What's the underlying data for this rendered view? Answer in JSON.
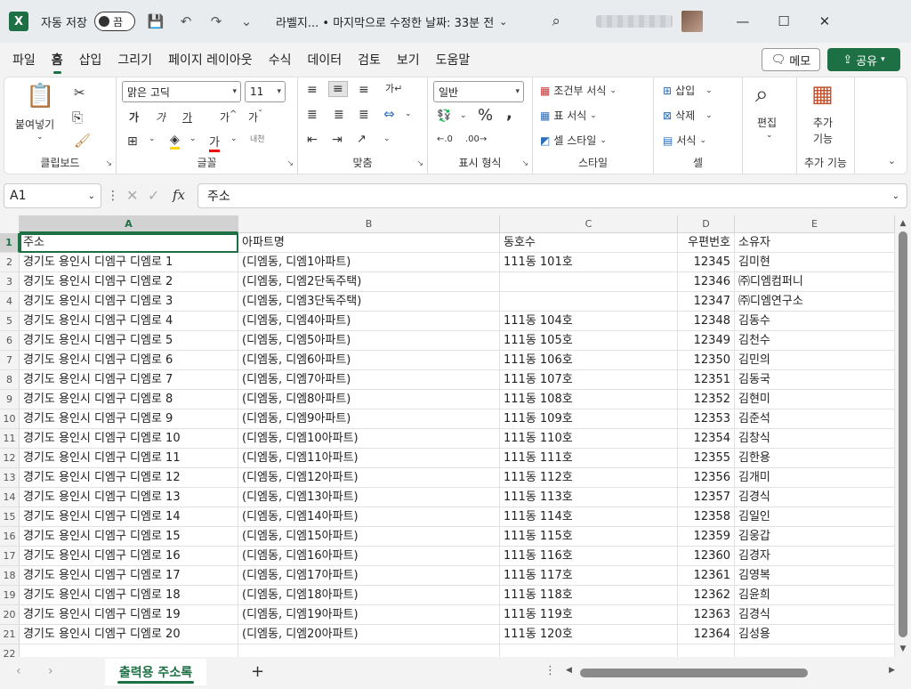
{
  "titlebar": {
    "app_icon": "X",
    "autosave_label": "자동 저장",
    "autosave_state": "끔",
    "doc_title": "라벨지... • 마지막으로 수정한 날짜: 33분 전",
    "doc_title_chevron": "⌄"
  },
  "menu": {
    "items": [
      "파일",
      "홈",
      "삽입",
      "그리기",
      "페이지 레이아웃",
      "수식",
      "데이터",
      "검토",
      "보기",
      "도움말"
    ],
    "active": "홈",
    "memo_label": "메모",
    "share_label": "공유"
  },
  "ribbon": {
    "clipboard": {
      "paste": "붙여넣기",
      "label": "클립보드"
    },
    "font": {
      "name": "맑은 고딕",
      "size": "11",
      "label": "글꼴"
    },
    "align": {
      "label": "맞춤"
    },
    "number": {
      "format": "일반",
      "label": "표시 형식"
    },
    "style": {
      "conditional": "조건부 서식",
      "table": "표 서식",
      "cell": "셀 스타일",
      "label": "스타일"
    },
    "cells": {
      "insert": "삽입",
      "delete": "삭제",
      "format": "서식",
      "label": "셀"
    },
    "editing": {
      "label": "편집"
    },
    "addins": {
      "label_line1": "추가",
      "label_line2": "기능",
      "group_label": "추가 기능"
    }
  },
  "formula_bar": {
    "name_box": "A1",
    "formula": "주소"
  },
  "grid": {
    "columns": [
      "A",
      "B",
      "C",
      "D",
      "E"
    ],
    "rows": [
      {
        "n": "1",
        "a": "주소",
        "b": "아파트명",
        "c": "동호수",
        "d": "우편번호",
        "e": "소유자"
      },
      {
        "n": "2",
        "a": "경기도 용인시 디엠구 디엠로 1",
        "b": "(디엠동, 디엠1아파트)",
        "c": "111동 101호",
        "d": "12345",
        "e": "김미현"
      },
      {
        "n": "3",
        "a": "경기도 용인시 디엠구 디엠로 2",
        "b": "(디엠동, 디엠2단독주택)",
        "c": "",
        "d": "12346",
        "e": "㈜디엠컴퍼니"
      },
      {
        "n": "4",
        "a": "경기도 용인시 디엠구 디엠로 3",
        "b": "(디엠동, 디엠3단독주택)",
        "c": "",
        "d": "12347",
        "e": "㈜디엠연구소"
      },
      {
        "n": "5",
        "a": "경기도 용인시 디엠구 디엠로 4",
        "b": "(디엠동, 디엠4아파트)",
        "c": "111동 104호",
        "d": "12348",
        "e": "김동수"
      },
      {
        "n": "6",
        "a": "경기도 용인시 디엠구 디엠로 5",
        "b": "(디엠동, 디엠5아파트)",
        "c": "111동 105호",
        "d": "12349",
        "e": "김천수"
      },
      {
        "n": "7",
        "a": "경기도 용인시 디엠구 디엠로 6",
        "b": "(디엠동, 디엠6아파트)",
        "c": "111동 106호",
        "d": "12350",
        "e": "김민의"
      },
      {
        "n": "8",
        "a": "경기도 용인시 디엠구 디엠로 7",
        "b": "(디엠동, 디엠7아파트)",
        "c": "111동 107호",
        "d": "12351",
        "e": "김동국"
      },
      {
        "n": "9",
        "a": "경기도 용인시 디엠구 디엠로 8",
        "b": "(디엠동, 디엠8아파트)",
        "c": "111동 108호",
        "d": "12352",
        "e": "김현미"
      },
      {
        "n": "10",
        "a": "경기도 용인시 디엠구 디엠로 9",
        "b": "(디엠동, 디엠9아파트)",
        "c": "111동 109호",
        "d": "12353",
        "e": "김준석"
      },
      {
        "n": "11",
        "a": "경기도 용인시 디엠구 디엠로 10",
        "b": "(디엠동, 디엠10아파트)",
        "c": "111동 110호",
        "d": "12354",
        "e": "김창식"
      },
      {
        "n": "12",
        "a": "경기도 용인시 디엠구 디엠로 11",
        "b": "(디엠동, 디엠11아파트)",
        "c": "111동 111호",
        "d": "12355",
        "e": "김한용"
      },
      {
        "n": "13",
        "a": "경기도 용인시 디엠구 디엠로 12",
        "b": "(디엠동, 디엠12아파트)",
        "c": "111동 112호",
        "d": "12356",
        "e": "김개미"
      },
      {
        "n": "14",
        "a": "경기도 용인시 디엠구 디엠로 13",
        "b": "(디엠동, 디엠13아파트)",
        "c": "111동 113호",
        "d": "12357",
        "e": "김경식"
      },
      {
        "n": "15",
        "a": "경기도 용인시 디엠구 디엠로 14",
        "b": "(디엠동, 디엠14아파트)",
        "c": "111동 114호",
        "d": "12358",
        "e": "김일인"
      },
      {
        "n": "16",
        "a": "경기도 용인시 디엠구 디엠로 15",
        "b": "(디엠동, 디엠15아파트)",
        "c": "111동 115호",
        "d": "12359",
        "e": "김웅갑"
      },
      {
        "n": "17",
        "a": "경기도 용인시 디엠구 디엠로 16",
        "b": "(디엠동, 디엠16아파트)",
        "c": "111동 116호",
        "d": "12360",
        "e": "김경자"
      },
      {
        "n": "18",
        "a": "경기도 용인시 디엠구 디엠로 17",
        "b": "(디엠동, 디엠17아파트)",
        "c": "111동 117호",
        "d": "12361",
        "e": "김영복"
      },
      {
        "n": "19",
        "a": "경기도 용인시 디엠구 디엠로 18",
        "b": "(디엠동, 디엠18아파트)",
        "c": "111동 118호",
        "d": "12362",
        "e": "김윤희"
      },
      {
        "n": "20",
        "a": "경기도 용인시 디엠구 디엠로 19",
        "b": "(디엠동, 디엠19아파트)",
        "c": "111동 119호",
        "d": "12363",
        "e": "김경식"
      },
      {
        "n": "21",
        "a": "경기도 용인시 디엠구 디엠로 20",
        "b": "(디엠동, 디엠20아파트)",
        "c": "111동 120호",
        "d": "12364",
        "e": "김성용"
      },
      {
        "n": "22",
        "a": "",
        "b": "",
        "c": "",
        "d": "",
        "e": ""
      }
    ]
  },
  "sheets": {
    "active_tab": "출력용 주소록",
    "add_symbol": "+"
  },
  "colors": {
    "accent": "#1d7044"
  }
}
